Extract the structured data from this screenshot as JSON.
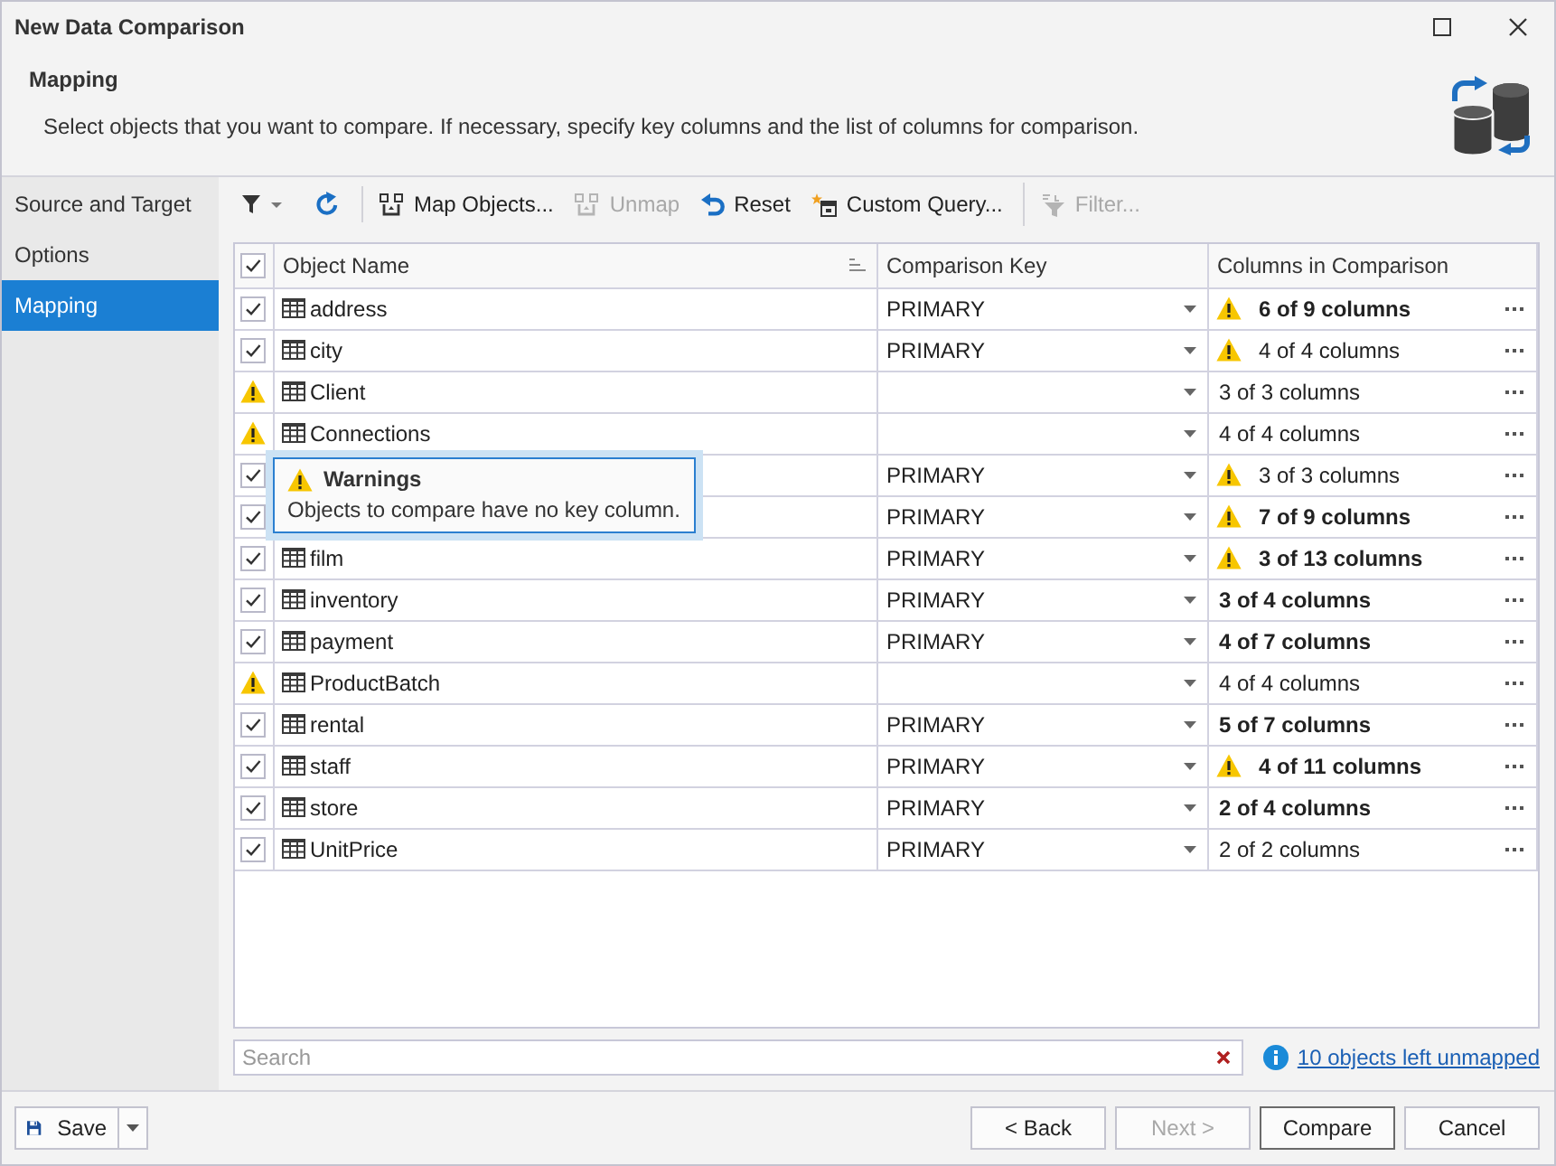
{
  "window": {
    "title": "New Data Comparison"
  },
  "header": {
    "title": "Mapping",
    "description": "Select objects that you want to compare. If necessary, specify key columns and the list of columns for comparison."
  },
  "sidebar": {
    "items": [
      {
        "label": "Source and Target",
        "selected": false
      },
      {
        "label": "Options",
        "selected": false
      },
      {
        "label": "Mapping",
        "selected": true
      }
    ]
  },
  "toolbar": {
    "buttons": [
      {
        "label": "Map Objects...",
        "disabled": false
      },
      {
        "label": "Unmap",
        "disabled": true
      },
      {
        "label": "Reset",
        "disabled": false
      },
      {
        "label": "Custom Query...",
        "disabled": false
      },
      {
        "label": "Filter...",
        "disabled": true
      }
    ]
  },
  "table": {
    "all_checked": true,
    "columns": [
      "Object Name",
      "Comparison Key",
      "Columns in Comparison"
    ],
    "rows": [
      {
        "kind": "checkbox",
        "checked": true,
        "name": "address",
        "key": "PRIMARY",
        "columns_warning": true,
        "columns": "6 of 9 columns",
        "modified": true
      },
      {
        "kind": "checkbox",
        "checked": true,
        "name": "city",
        "key": "PRIMARY",
        "columns_warning": true,
        "columns": "4 of 4 columns",
        "modified": false
      },
      {
        "kind": "warning",
        "name": "Client",
        "columns_warning": false,
        "columns": "3 of 3 columns",
        "modified": false
      },
      {
        "kind": "warning",
        "name": "Connections",
        "columns_warning": false,
        "columns": "4 of 4 columns",
        "modified": false
      },
      {
        "kind": "checkbox",
        "checked": true,
        "key": "PRIMARY",
        "columns_warning": true,
        "columns": "3 of 3 columns",
        "modified": false
      },
      {
        "kind": "checkbox",
        "checked": true,
        "key": "PRIMARY",
        "columns_warning": true,
        "columns": "7 of 9 columns",
        "modified": true
      },
      {
        "kind": "checkbox",
        "checked": true,
        "name": "film",
        "key": "PRIMARY",
        "columns_warning": true,
        "columns": "3 of 13 columns",
        "modified": true
      },
      {
        "kind": "checkbox",
        "checked": true,
        "name": "inventory",
        "key": "PRIMARY",
        "columns_warning": false,
        "columns": "3 of 4 columns",
        "modified": true
      },
      {
        "kind": "checkbox",
        "checked": true,
        "name": "payment",
        "key": "PRIMARY",
        "columns_warning": false,
        "columns": "4 of 7 columns",
        "modified": true
      },
      {
        "kind": "warning",
        "name": "ProductBatch",
        "columns_warning": false,
        "columns": "4 of 4 columns",
        "modified": false
      },
      {
        "kind": "checkbox",
        "checked": true,
        "name": "rental",
        "key": "PRIMARY",
        "columns_warning": false,
        "columns": "5 of 7 columns",
        "modified": true
      },
      {
        "kind": "checkbox",
        "checked": true,
        "name": "staff",
        "key": "PRIMARY",
        "columns_warning": true,
        "columns": "4 of 11 columns",
        "modified": true
      },
      {
        "kind": "checkbox",
        "checked": true,
        "name": "store",
        "key": "PRIMARY",
        "columns_warning": false,
        "columns": "2 of 4 columns",
        "modified": true
      },
      {
        "kind": "checkbox",
        "checked": true,
        "name": "UnitPrice",
        "key": "PRIMARY",
        "columns_warning": false,
        "columns": "2 of 2 columns",
        "modified": false
      }
    ]
  },
  "tooltip": {
    "title": "Warnings",
    "text": "Objects to compare have no key column."
  },
  "search": {
    "placeholder": "Search"
  },
  "unmapped_link": "10 objects left unmapped",
  "footer": {
    "save": "Save",
    "buttons": [
      {
        "label": "< Back",
        "disabled": false,
        "default": false
      },
      {
        "label": "Next >",
        "disabled": true,
        "default": false
      },
      {
        "label": "Compare",
        "disabled": false,
        "default": true
      },
      {
        "label": "Cancel",
        "disabled": false,
        "default": false
      }
    ]
  }
}
